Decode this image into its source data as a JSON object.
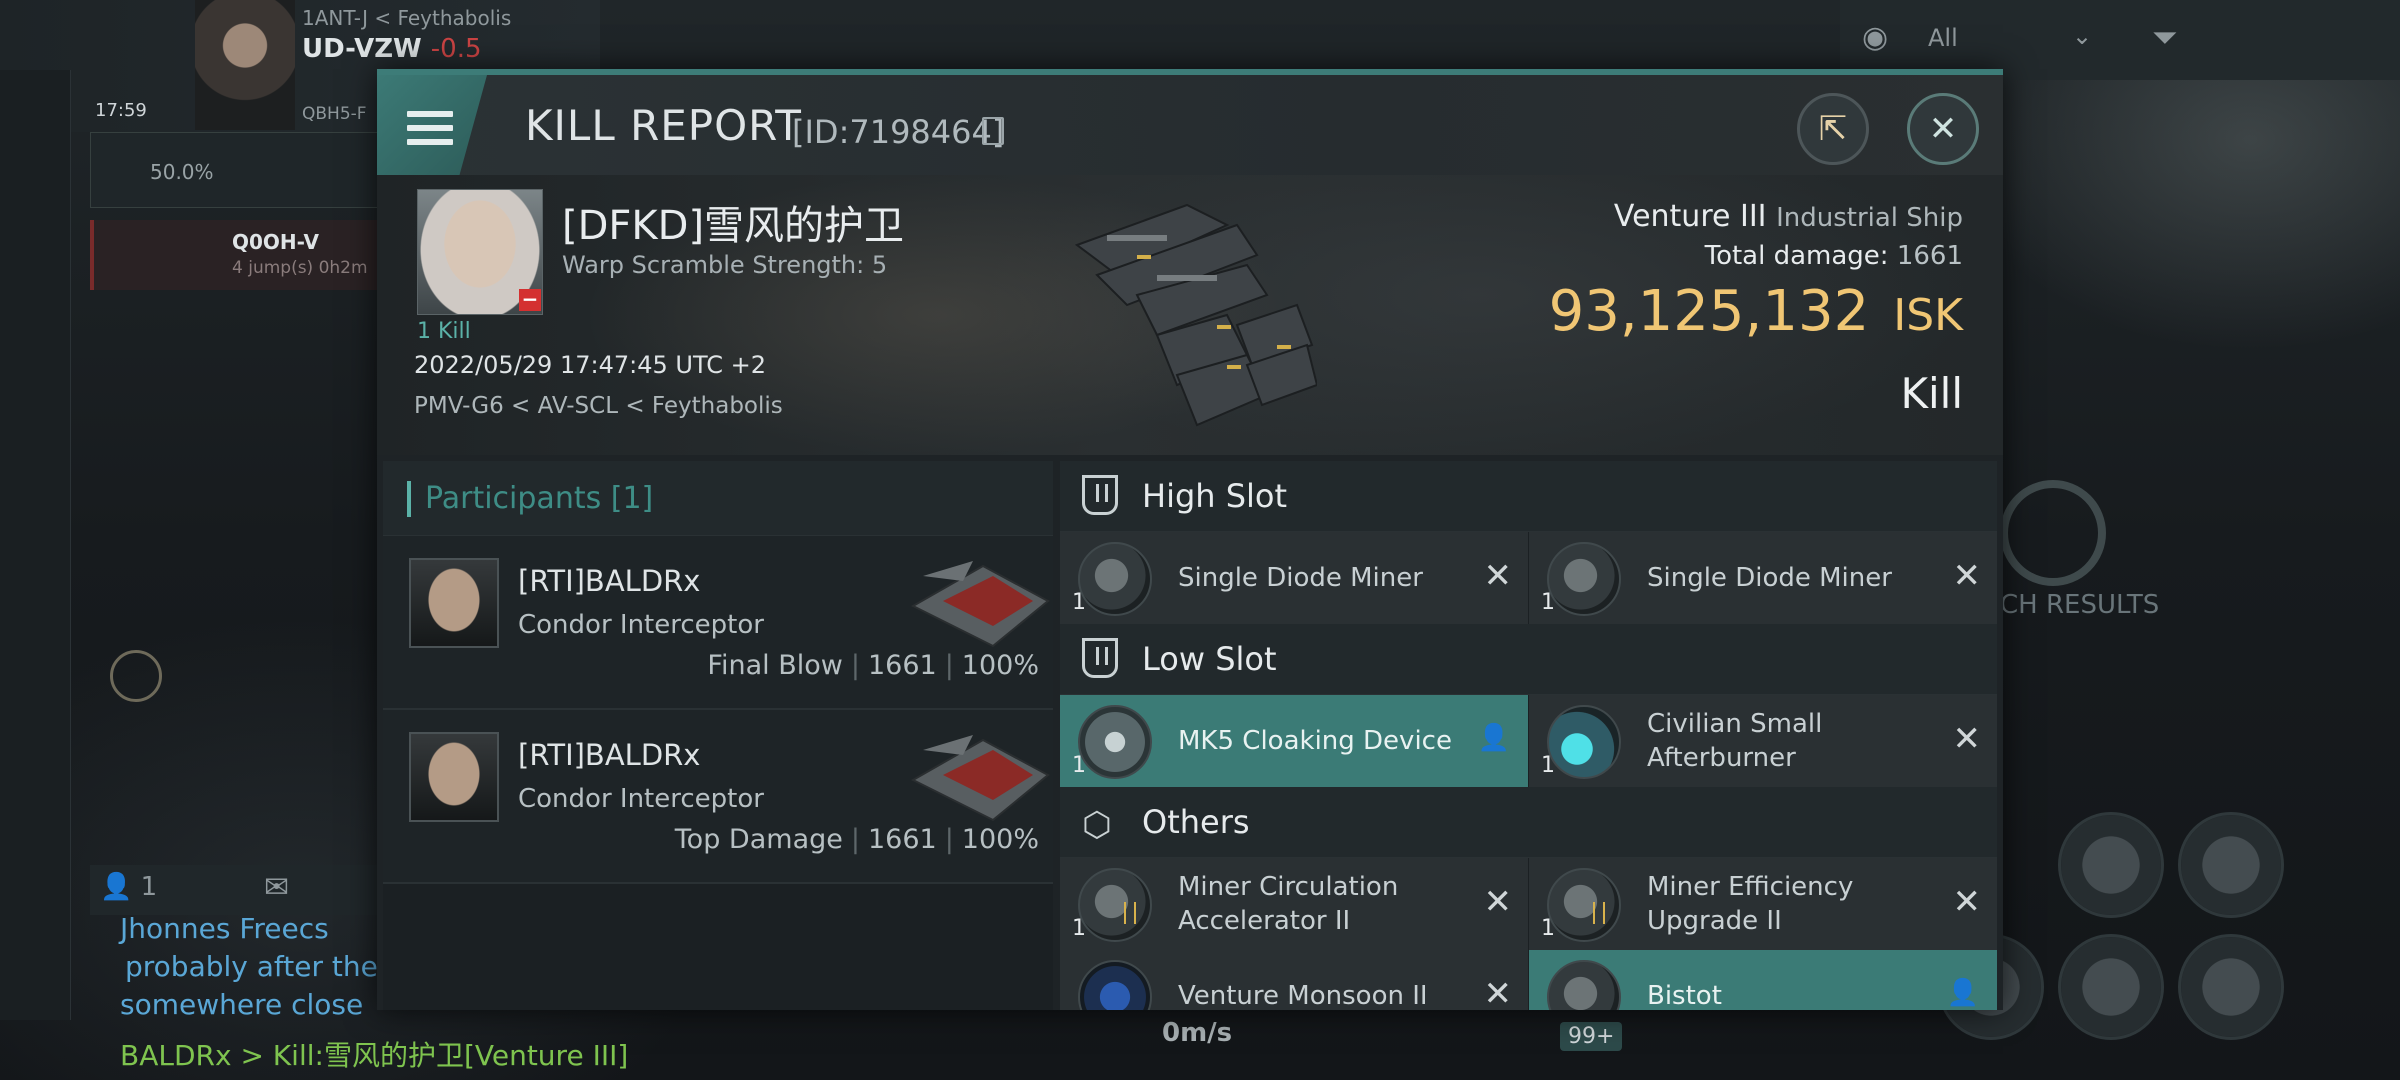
{
  "background": {
    "system_link": "1ANT-J",
    "region_link": "Feythabolis",
    "current_system": "UD-VZW",
    "security": "-0.5",
    "clock": "17:59",
    "next_system": "QBH5-F",
    "cargo_pct": "50.0%",
    "route_dest": "Q0OH-V",
    "route_jumps": "4 jump(s) 0h2m",
    "filter_label": "All",
    "search_results": "CH RESULTS",
    "chat_count": "1",
    "chat_name": "Jhonnes Freecs",
    "chat_line2": "probably after the",
    "chat_line3": "somewhere close",
    "chat_kill": "BALDRx > Kill:雪风的护卫[Venture III]",
    "speed": "0m/s",
    "badge": "99+"
  },
  "dialog": {
    "title": "KILL REPORT",
    "report_id": "[ID:7198464]",
    "victim": {
      "name": "[DFKD]雪风的护卫",
      "warp": "Warp Scramble Strength: 5",
      "kills": "1 Kill",
      "datetime": "2022/05/29 17:47:45 UTC +2",
      "location": "PMV-G6 < AV-SCL < Feythabolis"
    },
    "ship": {
      "name": "Venture III",
      "class": "Industrial Ship",
      "damage_label": "Total damage:",
      "damage_value": "1661",
      "isk_value": "93,125,132",
      "isk_unit": "ISK",
      "result": "Kill"
    },
    "participants": {
      "header": "Participants [1]",
      "rows": [
        {
          "name": "[RTI]BALDRx",
          "ship": "Condor Interceptor",
          "role": "Final Blow",
          "damage": "1661",
          "pct": "100%"
        },
        {
          "name": "[RTI]BALDRx",
          "ship": "Condor Interceptor",
          "role": "Top Damage",
          "damage": "1661",
          "pct": "100%"
        }
      ]
    },
    "slots": {
      "high": {
        "label": "High Slot",
        "items": [
          {
            "name": "Single Diode Miner",
            "qty": "1"
          },
          {
            "name": "Single Diode Miner",
            "qty": "1"
          }
        ]
      },
      "low": {
        "label": "Low Slot",
        "items": [
          {
            "name": "MK5 Cloaking Device",
            "qty": "1"
          },
          {
            "name": "Civilian Small Afterburner",
            "qty": "1"
          }
        ]
      },
      "others": {
        "label": "Others",
        "items": [
          {
            "name": "Miner Circulation Accelerator II",
            "qty": "1"
          },
          {
            "name": "Miner Efficiency Upgrade II",
            "qty": "1"
          },
          {
            "name": "Venture Monsoon II",
            "qty": ""
          },
          {
            "name": "Bistot",
            "qty": ""
          }
        ]
      }
    }
  }
}
